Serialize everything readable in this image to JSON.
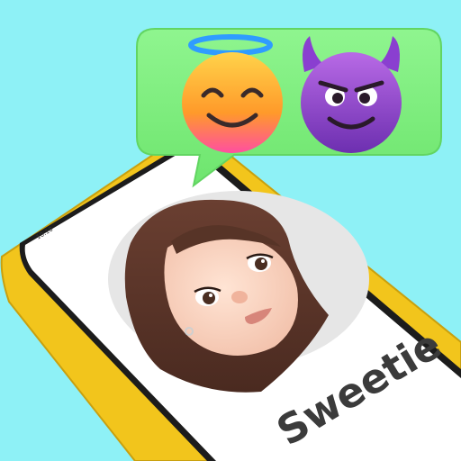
{
  "app": {
    "contact_name": "Sweetie",
    "status_time": "10:10"
  },
  "bubble": {
    "emojis": [
      {
        "name": "smiling-face-with-halo",
        "icon": "halo-smile-icon"
      },
      {
        "name": "smiling-face-with-horns",
        "icon": "devil-face-icon"
      }
    ]
  },
  "colors": {
    "background": "#8ef1f6",
    "bubble": "#7ef07e",
    "phone_frame": "#f2c51c",
    "phone_screen": "#ffffff",
    "avatar_circle": "#e6e6e6",
    "name_text": "#3b3b3b"
  }
}
